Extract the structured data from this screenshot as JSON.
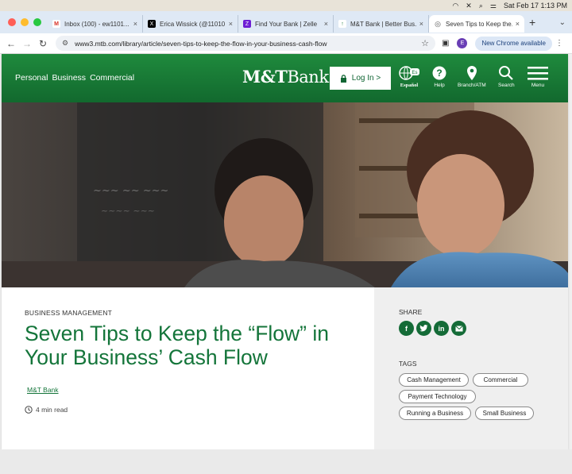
{
  "menubar": {
    "datetime": "Sat Feb 17  1:13 PM"
  },
  "browser": {
    "tabs": [
      {
        "label": "Inbox (100) - ew1101...",
        "icon": "gmail-icon",
        "color": "#d93025",
        "glyph": "M"
      },
      {
        "label": "Erica Wissick (@11010...",
        "icon": "x-icon",
        "color": "#000000",
        "glyph": "X"
      },
      {
        "label": "Find Your Bank | Zelle",
        "icon": "zelle-icon",
        "color": "#6d1ed4",
        "glyph": "Z"
      },
      {
        "label": "M&T Bank | Better Bus...",
        "icon": "mtb-icon",
        "color": "#1a7a3c",
        "glyph": "↑"
      },
      {
        "label": "Seven Tips to Keep the...",
        "icon": "globe-icon",
        "color": "#555555",
        "glyph": "◎"
      }
    ],
    "url": "www3.mtb.com/library/article/seven-tips-to-keep-the-flow-in-your-business-cash-flow",
    "profile_initial": "E",
    "new_chrome_label": "New Chrome available"
  },
  "site": {
    "nav": {
      "personal": "Personal",
      "business": "Business",
      "commercial": "Commercial"
    },
    "logo": {
      "bold": "M&T",
      "rest": "Bank"
    },
    "login_label": "Log In >",
    "header_items": [
      {
        "label": "Español",
        "icon": "espanol-globe-icon"
      },
      {
        "label": "Help",
        "icon": "help-icon"
      },
      {
        "label": "Branch/ATM",
        "icon": "location-pin-icon"
      },
      {
        "label": "Search",
        "icon": "search-icon"
      },
      {
        "label": "Menu",
        "icon": "hamburger-menu-icon"
      }
    ],
    "article": {
      "kicker": "BUSINESS MANAGEMENT",
      "title": "Seven Tips to Keep the “Flow” in Your Business’ Cash Flow",
      "author": "M&T Bank",
      "read_time": "4 min read"
    },
    "share": {
      "label": "SHARE",
      "networks": [
        {
          "name": "facebook-icon",
          "glyph": "f"
        },
        {
          "name": "twitter-icon",
          "glyph": "t"
        },
        {
          "name": "linkedin-icon",
          "glyph": "in"
        },
        {
          "name": "email-icon",
          "glyph": "✉"
        }
      ]
    },
    "tags": {
      "label": "TAGS",
      "items": [
        "Cash Management",
        "Commercial",
        "Payment Technology",
        "Running a Business",
        "Small Business"
      ]
    },
    "colors": {
      "brand_green": "#14753a",
      "header_green": "#1f8a3d"
    }
  }
}
